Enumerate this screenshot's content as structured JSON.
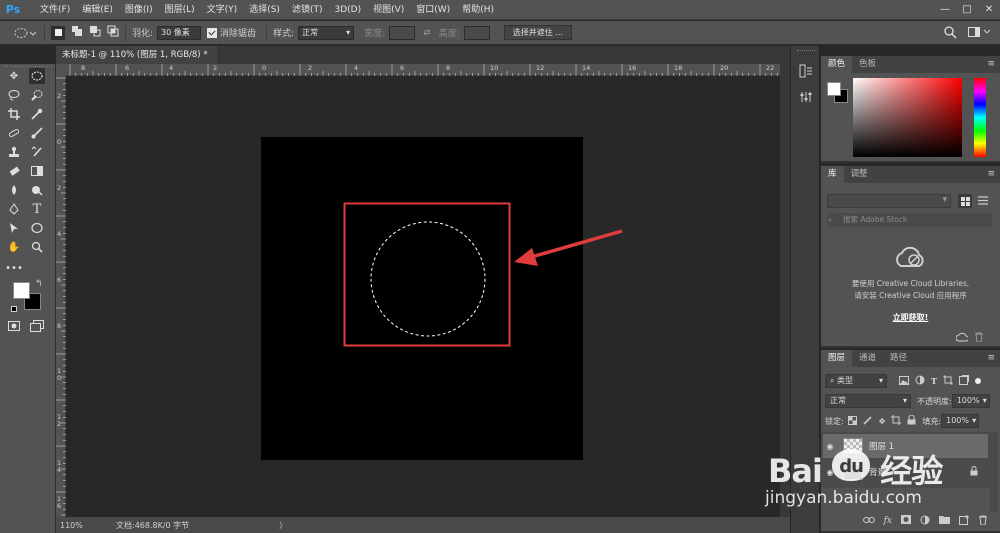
{
  "app": {
    "logo": "Ps"
  },
  "menu": [
    "文件(F)",
    "编辑(E)",
    "图像(I)",
    "图层(L)",
    "文字(Y)",
    "选择(S)",
    "滤镜(T)",
    "3D(D)",
    "视图(V)",
    "窗口(W)",
    "帮助(H)"
  ],
  "window_controls": {
    "minimize": "—",
    "maximize": "□",
    "close": "✕"
  },
  "options_bar": {
    "feather_label": "羽化:",
    "feather_value": "30 像素",
    "antialias_label": "消除锯齿",
    "antialias_checked": true,
    "style_label": "样式:",
    "style_value": "正常",
    "width_label": "宽度:",
    "height_label": "高度:",
    "select_mask_button": "选择并遮住 ..."
  },
  "document_tab": {
    "title": "未标题-1 @ 110% (图层 1, RGB/8) *",
    "close": "×"
  },
  "ruler_h": [
    "8",
    "6",
    "4",
    "2",
    "0",
    "2",
    "4",
    "6",
    "8",
    "10",
    "12",
    "14",
    "16",
    "18",
    "20",
    "22"
  ],
  "ruler_v": [
    "2",
    "0",
    "2",
    "4",
    "6",
    "8",
    "1 0",
    "1 2",
    "1 4",
    "1 6",
    "1 8",
    "2 0",
    "2 2"
  ],
  "status": {
    "zoom": "110%",
    "doc_info": "文档:468.8K/0 字节",
    "arrow": "〉"
  },
  "color_panel": {
    "tabs": [
      "颜色",
      "色板"
    ],
    "active_tab": 0
  },
  "library_panel": {
    "tabs": [
      "库",
      "调整"
    ],
    "active_tab": 0,
    "search_placeholder": "搜索 Adobe Stock",
    "message_line1": "要使用 Creative Cloud Libraries,",
    "message_line2": "请安装 Creative Cloud 应用程序",
    "link": "立即获取!"
  },
  "layers_panel": {
    "tabs": [
      "图层",
      "通道",
      "路径"
    ],
    "active_tab": 0,
    "filter_value": "类型",
    "blend_mode": "正常",
    "opacity_label": "不透明度:",
    "opacity_value": "100%",
    "lock_label": "锁定:",
    "fill_label": "填充:",
    "fill_value": "100%",
    "layers": [
      {
        "name": "图层 1",
        "selected": true
      },
      {
        "name": "背景",
        "selected": false
      }
    ],
    "footer_icons": [
      "link-icon",
      "fx-icon",
      "mask-icon",
      "adjustment-icon",
      "folder-icon",
      "new-layer-icon",
      "trash-icon"
    ],
    "fx_label": "fx"
  },
  "annotation": {
    "highlight_color": "#e03c3c"
  },
  "watermark": {
    "logo_left": "Bai",
    "logo_mid": "du",
    "logo_right": "经验",
    "url": "jingyan.baidu.com"
  }
}
